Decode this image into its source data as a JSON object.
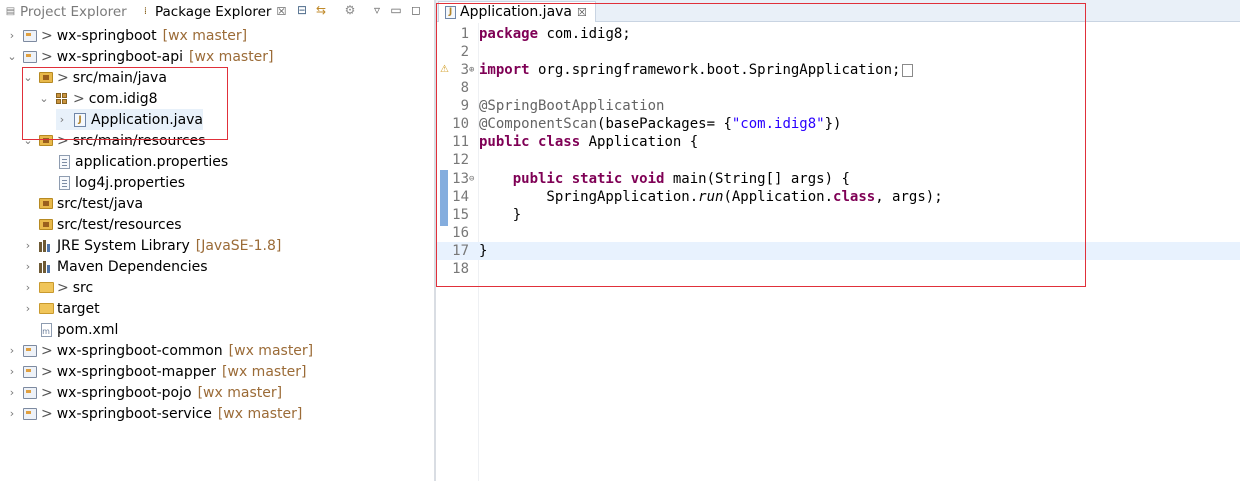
{
  "explorer": {
    "tabs": {
      "project_explorer": "Project Explorer",
      "package_explorer": "Package Explorer"
    },
    "toolbar_icons": [
      "collapse-all-icon",
      "link-with-editor-icon",
      "focus-icon",
      "view-menu-icon",
      "minimize-icon",
      "maximize-icon"
    ],
    "items": [
      {
        "label": "wx-springboot",
        "decoration": "[wx master]"
      },
      {
        "label": "wx-springboot-api",
        "decoration": "[wx master]"
      },
      {
        "label": "src/main/java"
      },
      {
        "label": "com.idig8"
      },
      {
        "label": "Application.java"
      },
      {
        "label": "src/main/resources"
      },
      {
        "label": "application.properties"
      },
      {
        "label": "log4j.properties"
      },
      {
        "label": "src/test/java"
      },
      {
        "label": "src/test/resources"
      },
      {
        "label": "JRE System Library",
        "decoration": "[JavaSE-1.8]"
      },
      {
        "label": "Maven Dependencies"
      },
      {
        "label": "src"
      },
      {
        "label": "target"
      },
      {
        "label": "pom.xml"
      },
      {
        "label": "wx-springboot-common",
        "decoration": "[wx master]"
      },
      {
        "label": "wx-springboot-mapper",
        "decoration": "[wx master]"
      },
      {
        "label": "wx-springboot-pojo",
        "decoration": "[wx master]"
      },
      {
        "label": "wx-springboot-service",
        "decoration": "[wx master]"
      }
    ]
  },
  "editor": {
    "tab_label": "Application.java",
    "line_numbers": [
      "1",
      "2",
      "3",
      "8",
      "9",
      "10",
      "11",
      "12",
      "13",
      "14",
      "15",
      "16",
      "17",
      "18"
    ],
    "code": {
      "l1_kw": "package",
      "l1_rest": " com.idig8;",
      "l3_kw": "import",
      "l3_rest": " org.springframework.boot.SpringApplication;",
      "l9": "@SpringBootApplication",
      "l10_ann": "@ComponentScan",
      "l10_mid": "(basePackages= {",
      "l10_str": "\"com.idig8\"",
      "l10_end": "})",
      "l11_kw": "public class",
      "l11_rest": " Application {",
      "l13_indent": "    ",
      "l13_kw": "public static void",
      "l13_rest": " main(String[] args) {",
      "l14_a": "        SpringApplication.",
      "l14_b": "run",
      "l14_c": "(Application.",
      "l14_kw": "class",
      "l14_d": ", args);",
      "l15": "    }",
      "l17": "}"
    }
  }
}
